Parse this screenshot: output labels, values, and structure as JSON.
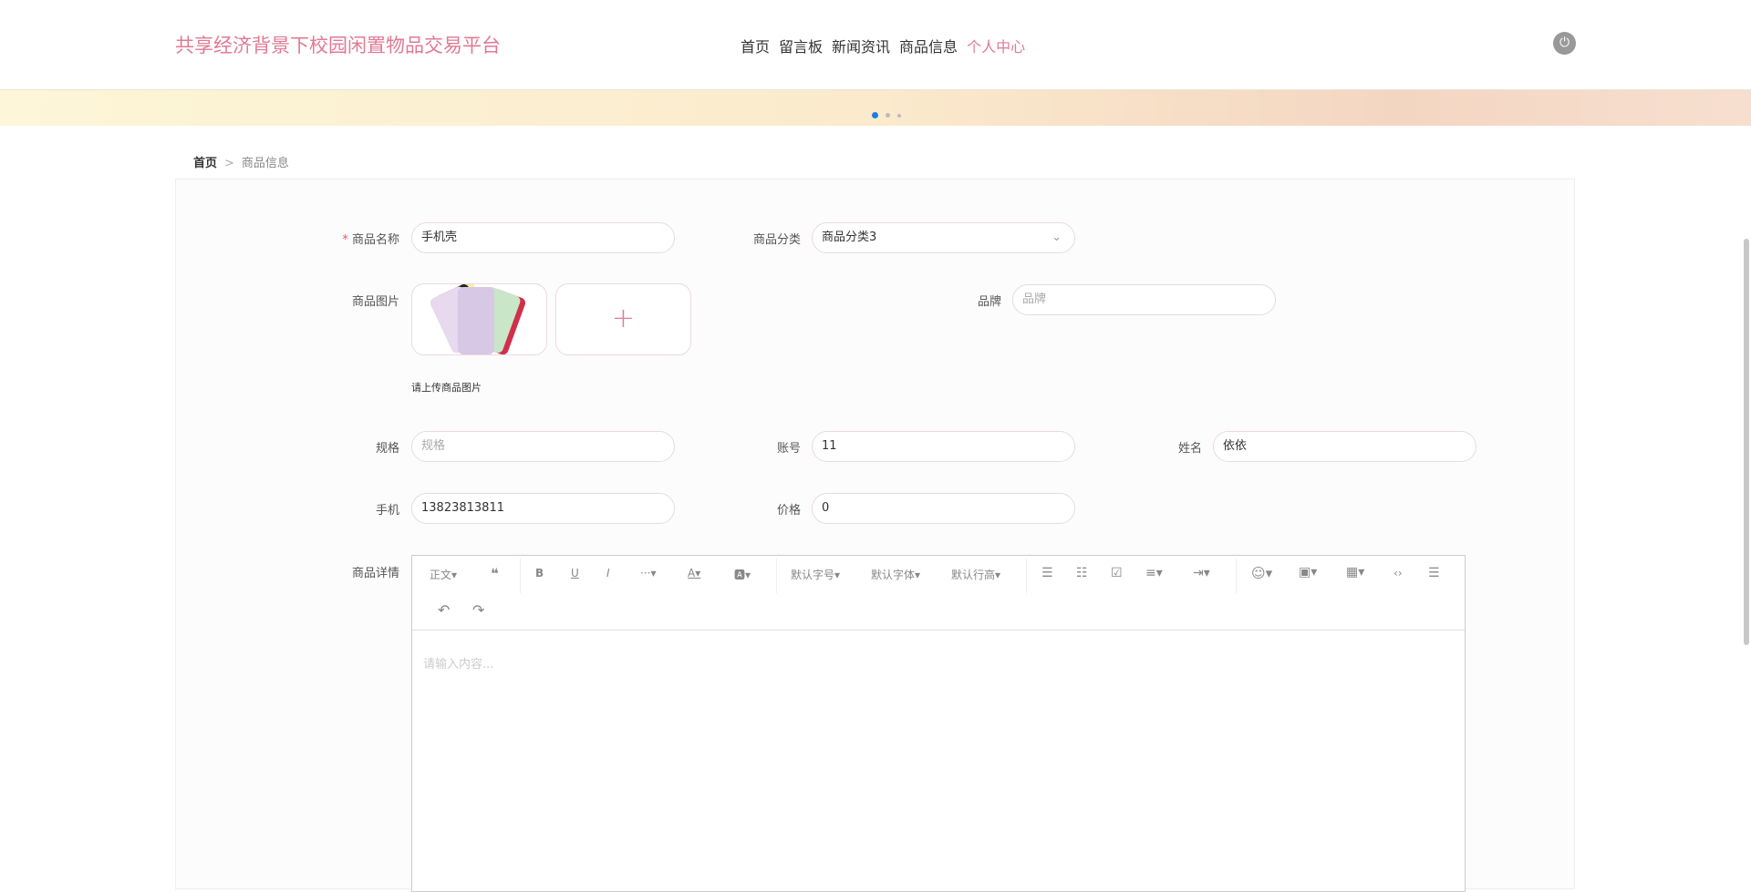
{
  "header": {
    "title": "共享经济背景下校园闲置物品交易平台",
    "nav": [
      "首页",
      "留言板",
      "新闻资讯",
      "商品信息",
      "个人中心"
    ],
    "active_nav": 4,
    "power_icon": "power-icon"
  },
  "breadcrumb": {
    "home": "首页",
    "sep": ">",
    "current": "商品信息"
  },
  "form": {
    "name": {
      "label": "商品名称",
      "required": "*",
      "value": "手机壳"
    },
    "category": {
      "label": "商品分类",
      "value": "商品分类3"
    },
    "image": {
      "label": "商品图片",
      "hint": "请上传商品图片",
      "add": "+"
    },
    "brand": {
      "label": "品牌",
      "placeholder": "品牌"
    },
    "spec": {
      "label": "规格",
      "placeholder": "规格"
    },
    "account": {
      "label": "账号",
      "value": "11"
    },
    "realname": {
      "label": "姓名",
      "value": "依依"
    },
    "phone": {
      "label": "手机",
      "value": "13823813811"
    },
    "price": {
      "label": "价格",
      "value": "0"
    },
    "detail": {
      "label": "商品详情",
      "placeholder": "请输入内容...",
      "toolbar": {
        "para": "正文▾",
        "quote": "❝",
        "bold": "B",
        "underline": "U",
        "italic": "I",
        "more": "···▾",
        "fontcolor": "A▾",
        "bgcolor": "🅰▾",
        "fontsize": "默认字号▾",
        "fontfamily": "默认字体▾",
        "lineheight": "默认行高▾",
        "ul": "☰",
        "ol": "☷",
        "todo": "☑",
        "align": "≡▾",
        "indent": "⇥▾",
        "emoji": "☺▾",
        "image": "▣▾",
        "table": "▦▾",
        "code": "‹›",
        "hr": "☰",
        "undo": "↶",
        "redo": "↷"
      }
    }
  }
}
